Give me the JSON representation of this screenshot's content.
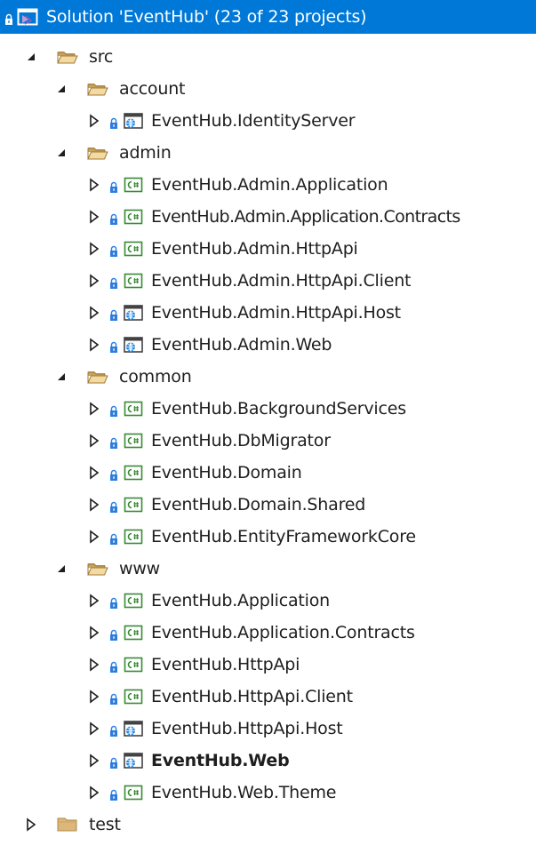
{
  "solution": {
    "title": "Solution 'EventHub' (23 of 23 projects)"
  },
  "folders": {
    "src": "src",
    "account": "account",
    "admin": "admin",
    "common": "common",
    "www": "www",
    "test": "test"
  },
  "projects": {
    "identity_server": "EventHub.IdentityServer",
    "admin_application": "EventHub.Admin.Application",
    "admin_application_contracts": "EventHub.Admin.Application.Contracts",
    "admin_httpapi": "EventHub.Admin.HttpApi",
    "admin_httpapi_client": "EventHub.Admin.HttpApi.Client",
    "admin_httpapi_host": "EventHub.Admin.HttpApi.Host",
    "admin_web": "EventHub.Admin.Web",
    "background_services": "EventHub.BackgroundServices",
    "db_migrator": "EventHub.DbMigrator",
    "domain": "EventHub.Domain",
    "domain_shared": "EventHub.Domain.Shared",
    "efcore": "EventHub.EntityFrameworkCore",
    "application": "EventHub.Application",
    "application_contracts": "EventHub.Application.Contracts",
    "httpapi": "EventHub.HttpApi",
    "httpapi_client": "EventHub.HttpApi.Client",
    "httpapi_host": "EventHub.HttpApi.Host",
    "web": "EventHub.Web",
    "web_theme": "EventHub.Web.Theme"
  },
  "colors": {
    "selection": "#0078d7",
    "lock": "#2b7de0",
    "folder_open": "#dcb67a",
    "folder_closed": "#dcb67a",
    "csharp_green": "#388a34",
    "web_blue": "#1e88e5"
  }
}
